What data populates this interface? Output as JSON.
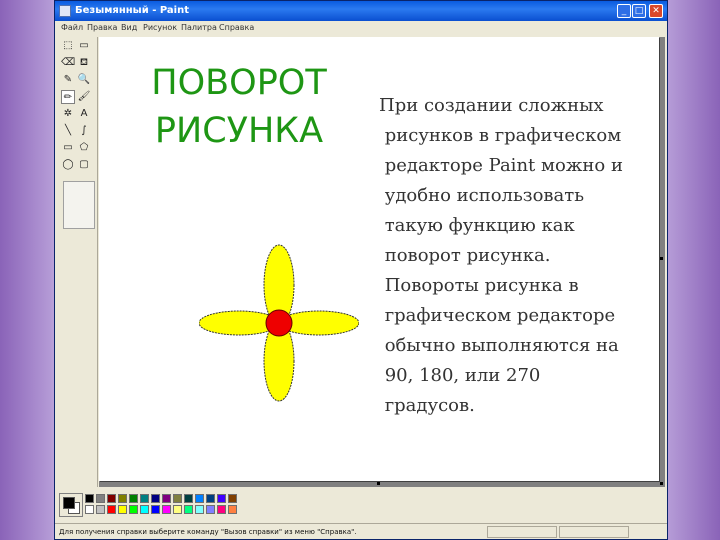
{
  "window": {
    "title": "Безымянный - Paint",
    "controls": {
      "minimize": "_",
      "maximize": "□",
      "close": "✕"
    }
  },
  "menu": [
    "Файл",
    "Правка",
    "Вид",
    "Рисунок",
    "Палитра",
    "Справка"
  ],
  "tools": [
    {
      "name": "free-select-tool",
      "glyph": "⬚"
    },
    {
      "name": "select-tool",
      "glyph": "▭"
    },
    {
      "name": "eraser-tool",
      "glyph": "⌫"
    },
    {
      "name": "fill-tool",
      "glyph": "⛾"
    },
    {
      "name": "pick-color-tool",
      "glyph": "✎"
    },
    {
      "name": "magnifier-tool",
      "glyph": "🔍"
    },
    {
      "name": "pencil-tool",
      "glyph": "✏"
    },
    {
      "name": "brush-tool",
      "glyph": "🖌"
    },
    {
      "name": "airbrush-tool",
      "glyph": "✲"
    },
    {
      "name": "text-tool",
      "glyph": "A"
    },
    {
      "name": "line-tool",
      "glyph": "╲"
    },
    {
      "name": "curve-tool",
      "glyph": "∫"
    },
    {
      "name": "rectangle-tool",
      "glyph": "▭"
    },
    {
      "name": "polygon-tool",
      "glyph": "⬠"
    },
    {
      "name": "ellipse-tool",
      "glyph": "◯"
    },
    {
      "name": "rounded-rect-tool",
      "glyph": "▢"
    }
  ],
  "canvas": {
    "heading": "ПОВОРОТ\nРИСУНКА",
    "body": "При создании сложных\n рисунков в графическом\n редакторе Paint можно и\n удобно использовать\n такую функцию как\n поворот рисунка.\n Повороты рисунка в\n графическом редакторе\n обычно выполняются на\n 90, 180, или 270\n градусов.",
    "flower": {
      "petal_color": "#ffff00",
      "center_color": "#ee0000"
    }
  },
  "palette": {
    "foreground": "#000000",
    "background": "#ffffff",
    "row1": [
      "#000000",
      "#808080",
      "#800000",
      "#808000",
      "#008000",
      "#008080",
      "#000080",
      "#800080",
      "#808040",
      "#004040",
      "#0080ff",
      "#004080",
      "#4000ff",
      "#804000"
    ],
    "row2": [
      "#ffffff",
      "#c0c0c0",
      "#ff0000",
      "#ffff00",
      "#00ff00",
      "#00ffff",
      "#0000ff",
      "#ff00ff",
      "#ffff80",
      "#00ff80",
      "#80ffff",
      "#8080ff",
      "#ff0080",
      "#ff8040"
    ]
  },
  "status": {
    "text": "Для получения справки выберите команду \"Вызов справки\" из меню \"Справка\"."
  }
}
